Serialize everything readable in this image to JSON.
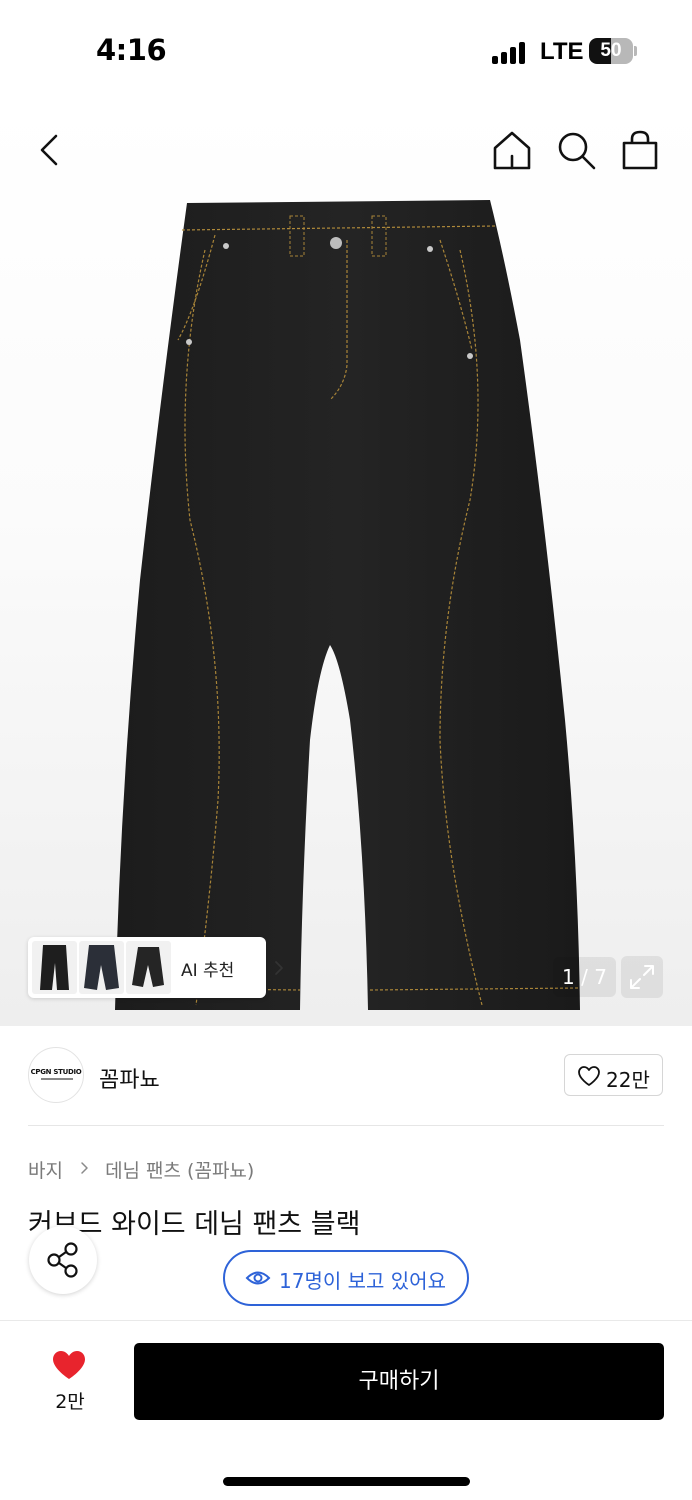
{
  "status_bar": {
    "time": "4:16",
    "network": "LTE",
    "battery": "50",
    "battery_level": 0.5
  },
  "nav": {
    "back_icon": "chevron-left-icon",
    "home_icon": "home-icon",
    "search_icon": "search-icon",
    "cart_icon": "shopping-bag-icon"
  },
  "hero": {
    "ai_recommend": {
      "label": "AI 추천"
    },
    "counter": "1 / 7",
    "expand_icon": "expand-icon"
  },
  "brand": {
    "name": "꼼파뇨",
    "logo_text": "CPGN STUDIO",
    "likes": "22만"
  },
  "product": {
    "breadcrumb": [
      "바지",
      "데님 팬츠 (꼼파뇨)"
    ],
    "title": "커브드 와이드 데님 팬츠 블랙",
    "viewers": "17명이 보고 있어요"
  },
  "bottom_bar": {
    "wish_count": "2만",
    "buy_label": "구매하기"
  },
  "colors": {
    "accent_blue": "#2e63d8",
    "heart_red": "#e8242d",
    "buy_bg": "#000000"
  }
}
